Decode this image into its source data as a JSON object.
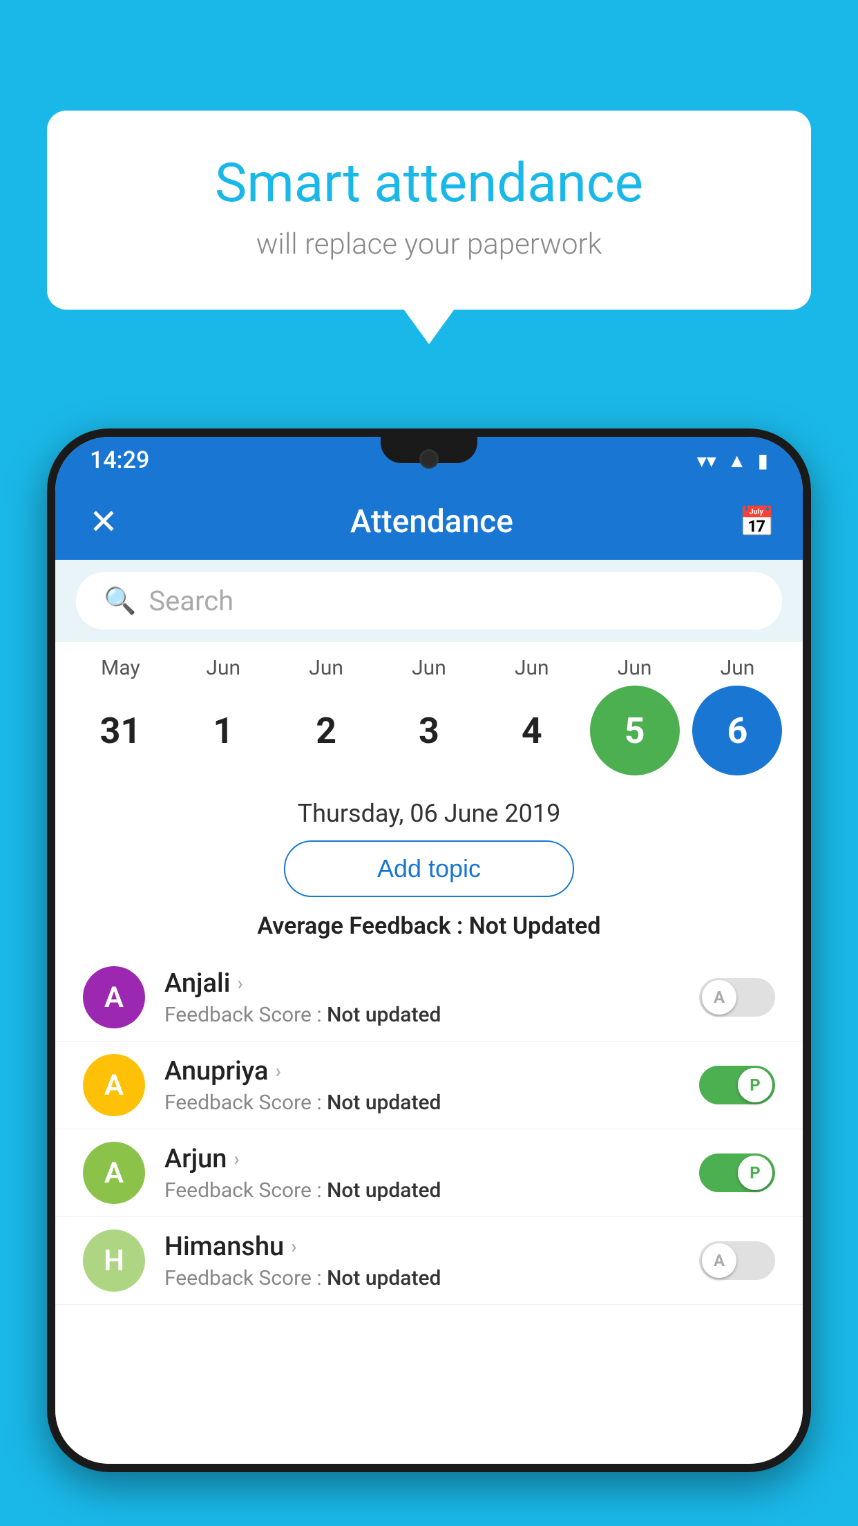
{
  "background_color": "#1ab8e8",
  "speech_bubble": {
    "title": "Smart attendance",
    "subtitle": "will replace your paperwork"
  },
  "status_bar": {
    "time": "14:29",
    "wifi_icon": "▼",
    "signal_icon": "▲",
    "battery_icon": "▮"
  },
  "app_bar": {
    "title": "Attendance",
    "close_icon": "✕",
    "calendar_icon": "📅"
  },
  "search": {
    "placeholder": "Search"
  },
  "calendar": {
    "months": [
      "May",
      "Jun",
      "Jun",
      "Jun",
      "Jun",
      "Jun",
      "Jun"
    ],
    "dates": [
      "31",
      "1",
      "2",
      "3",
      "4",
      "5",
      "6"
    ],
    "selected_date": "Thursday, 06 June 2019",
    "highlighted_green": 5,
    "highlighted_blue": 6
  },
  "add_topic": {
    "label": "Add topic"
  },
  "avg_feedback": {
    "label": "Average Feedback :",
    "value": "Not Updated"
  },
  "students": [
    {
      "name": "Anjali",
      "avatar_letter": "A",
      "avatar_color": "purple",
      "feedback_label": "Feedback Score :",
      "feedback_value": "Not updated",
      "toggle_state": "off",
      "toggle_label": "A"
    },
    {
      "name": "Anupriya",
      "avatar_letter": "A",
      "avatar_color": "yellow",
      "feedback_label": "Feedback Score :",
      "feedback_value": "Not updated",
      "toggle_state": "on",
      "toggle_label": "P"
    },
    {
      "name": "Arjun",
      "avatar_letter": "A",
      "avatar_color": "green",
      "feedback_label": "Feedback Score :",
      "feedback_value": "Not updated",
      "toggle_state": "on",
      "toggle_label": "P"
    },
    {
      "name": "Himanshu",
      "avatar_letter": "H",
      "avatar_color": "lightgreen",
      "feedback_label": "Feedback Score :",
      "feedback_value": "Not updated",
      "toggle_state": "off",
      "toggle_label": "A"
    }
  ]
}
